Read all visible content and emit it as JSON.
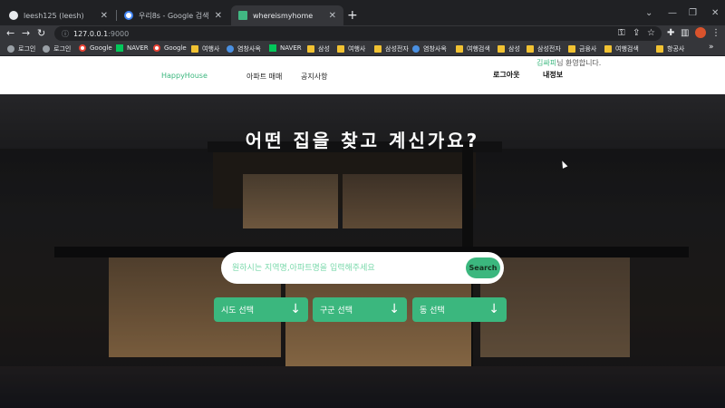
{
  "browser": {
    "tabs": [
      {
        "title": "leesh125 (leesh)",
        "icon": "github-icon"
      },
      {
        "title": "우리8s - Google 검색",
        "icon": "google-icon"
      },
      {
        "title": "whereismyhome",
        "icon": "vue-icon"
      }
    ],
    "url": "127.0.0.1",
    "port": ":9000",
    "bookmarks": [
      {
        "label": "로그인",
        "icon": "globe"
      },
      {
        "label": "로그인",
        "icon": "globe"
      },
      {
        "label": "Google",
        "icon": "google"
      },
      {
        "label": "NAVER",
        "icon": "naver"
      },
      {
        "label": "Google",
        "icon": "google"
      },
      {
        "label": "여행사",
        "icon": "folder"
      },
      {
        "label": "염창사옥",
        "icon": "globe"
      },
      {
        "label": "NAVER",
        "icon": "naver"
      },
      {
        "label": "삼성",
        "icon": "folder"
      },
      {
        "label": "여행사",
        "icon": "folder"
      },
      {
        "label": "삼성전자",
        "icon": "folder"
      },
      {
        "label": "염창사옥",
        "icon": "globe"
      },
      {
        "label": "여행검색",
        "icon": "folder"
      },
      {
        "label": "삼성",
        "icon": "folder"
      },
      {
        "label": "삼성전자",
        "icon": "folder"
      },
      {
        "label": "금융사",
        "icon": "folder"
      },
      {
        "label": "여행검색",
        "icon": "folder"
      },
      {
        "label": "항공사",
        "icon": "folder"
      }
    ]
  },
  "site": {
    "logo": "HappyHouse",
    "nav": {
      "apartment": "아파트 매매",
      "notice": "공지사항"
    },
    "user": {
      "name": "김싸피",
      "welcome_suffix": "님 환영합니다.",
      "logout": "로그아웃",
      "myinfo": "내정보"
    },
    "hero": {
      "headline": "어떤 집을 찾고 계신가요?",
      "search_placeholder": "원하시는 지역명,아파트명을 입력해주세요",
      "search_button": "Search",
      "selects": [
        "시도 선택",
        "구군 선택",
        "동 선택"
      ],
      "arrow": "↓"
    }
  },
  "colors": {
    "accent": "#3bb77e",
    "chrome_dark": "#202124",
    "chrome": "#35363a"
  }
}
